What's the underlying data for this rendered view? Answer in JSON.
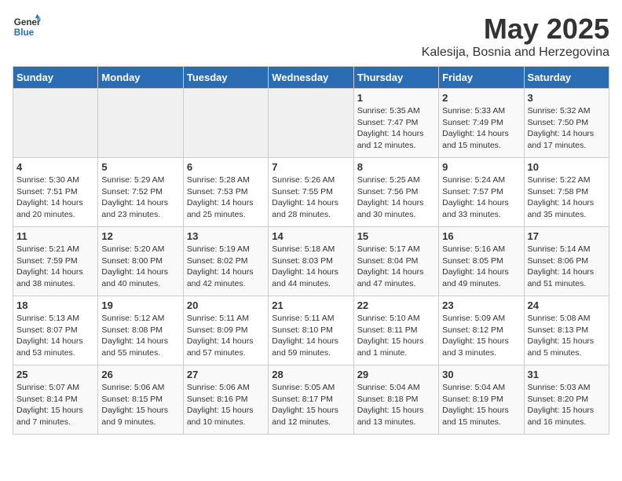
{
  "header": {
    "logo_line1": "General",
    "logo_line2": "Blue",
    "month_title": "May 2025",
    "subtitle": "Kalesija, Bosnia and Herzegovina"
  },
  "weekdays": [
    "Sunday",
    "Monday",
    "Tuesday",
    "Wednesday",
    "Thursday",
    "Friday",
    "Saturday"
  ],
  "weeks": [
    [
      {
        "day": "",
        "info": ""
      },
      {
        "day": "",
        "info": ""
      },
      {
        "day": "",
        "info": ""
      },
      {
        "day": "",
        "info": ""
      },
      {
        "day": "1",
        "info": "Sunrise: 5:35 AM\nSunset: 7:47 PM\nDaylight: 14 hours\nand 12 minutes."
      },
      {
        "day": "2",
        "info": "Sunrise: 5:33 AM\nSunset: 7:49 PM\nDaylight: 14 hours\nand 15 minutes."
      },
      {
        "day": "3",
        "info": "Sunrise: 5:32 AM\nSunset: 7:50 PM\nDaylight: 14 hours\nand 17 minutes."
      }
    ],
    [
      {
        "day": "4",
        "info": "Sunrise: 5:30 AM\nSunset: 7:51 PM\nDaylight: 14 hours\nand 20 minutes."
      },
      {
        "day": "5",
        "info": "Sunrise: 5:29 AM\nSunset: 7:52 PM\nDaylight: 14 hours\nand 23 minutes."
      },
      {
        "day": "6",
        "info": "Sunrise: 5:28 AM\nSunset: 7:53 PM\nDaylight: 14 hours\nand 25 minutes."
      },
      {
        "day": "7",
        "info": "Sunrise: 5:26 AM\nSunset: 7:55 PM\nDaylight: 14 hours\nand 28 minutes."
      },
      {
        "day": "8",
        "info": "Sunrise: 5:25 AM\nSunset: 7:56 PM\nDaylight: 14 hours\nand 30 minutes."
      },
      {
        "day": "9",
        "info": "Sunrise: 5:24 AM\nSunset: 7:57 PM\nDaylight: 14 hours\nand 33 minutes."
      },
      {
        "day": "10",
        "info": "Sunrise: 5:22 AM\nSunset: 7:58 PM\nDaylight: 14 hours\nand 35 minutes."
      }
    ],
    [
      {
        "day": "11",
        "info": "Sunrise: 5:21 AM\nSunset: 7:59 PM\nDaylight: 14 hours\nand 38 minutes."
      },
      {
        "day": "12",
        "info": "Sunrise: 5:20 AM\nSunset: 8:00 PM\nDaylight: 14 hours\nand 40 minutes."
      },
      {
        "day": "13",
        "info": "Sunrise: 5:19 AM\nSunset: 8:02 PM\nDaylight: 14 hours\nand 42 minutes."
      },
      {
        "day": "14",
        "info": "Sunrise: 5:18 AM\nSunset: 8:03 PM\nDaylight: 14 hours\nand 44 minutes."
      },
      {
        "day": "15",
        "info": "Sunrise: 5:17 AM\nSunset: 8:04 PM\nDaylight: 14 hours\nand 47 minutes."
      },
      {
        "day": "16",
        "info": "Sunrise: 5:16 AM\nSunset: 8:05 PM\nDaylight: 14 hours\nand 49 minutes."
      },
      {
        "day": "17",
        "info": "Sunrise: 5:14 AM\nSunset: 8:06 PM\nDaylight: 14 hours\nand 51 minutes."
      }
    ],
    [
      {
        "day": "18",
        "info": "Sunrise: 5:13 AM\nSunset: 8:07 PM\nDaylight: 14 hours\nand 53 minutes."
      },
      {
        "day": "19",
        "info": "Sunrise: 5:12 AM\nSunset: 8:08 PM\nDaylight: 14 hours\nand 55 minutes."
      },
      {
        "day": "20",
        "info": "Sunrise: 5:11 AM\nSunset: 8:09 PM\nDaylight: 14 hours\nand 57 minutes."
      },
      {
        "day": "21",
        "info": "Sunrise: 5:11 AM\nSunset: 8:10 PM\nDaylight: 14 hours\nand 59 minutes."
      },
      {
        "day": "22",
        "info": "Sunrise: 5:10 AM\nSunset: 8:11 PM\nDaylight: 15 hours\nand 1 minute."
      },
      {
        "day": "23",
        "info": "Sunrise: 5:09 AM\nSunset: 8:12 PM\nDaylight: 15 hours\nand 3 minutes."
      },
      {
        "day": "24",
        "info": "Sunrise: 5:08 AM\nSunset: 8:13 PM\nDaylight: 15 hours\nand 5 minutes."
      }
    ],
    [
      {
        "day": "25",
        "info": "Sunrise: 5:07 AM\nSunset: 8:14 PM\nDaylight: 15 hours\nand 7 minutes."
      },
      {
        "day": "26",
        "info": "Sunrise: 5:06 AM\nSunset: 8:15 PM\nDaylight: 15 hours\nand 9 minutes."
      },
      {
        "day": "27",
        "info": "Sunrise: 5:06 AM\nSunset: 8:16 PM\nDaylight: 15 hours\nand 10 minutes."
      },
      {
        "day": "28",
        "info": "Sunrise: 5:05 AM\nSunset: 8:17 PM\nDaylight: 15 hours\nand 12 minutes."
      },
      {
        "day": "29",
        "info": "Sunrise: 5:04 AM\nSunset: 8:18 PM\nDaylight: 15 hours\nand 13 minutes."
      },
      {
        "day": "30",
        "info": "Sunrise: 5:04 AM\nSunset: 8:19 PM\nDaylight: 15 hours\nand 15 minutes."
      },
      {
        "day": "31",
        "info": "Sunrise: 5:03 AM\nSunset: 8:20 PM\nDaylight: 15 hours\nand 16 minutes."
      }
    ]
  ]
}
